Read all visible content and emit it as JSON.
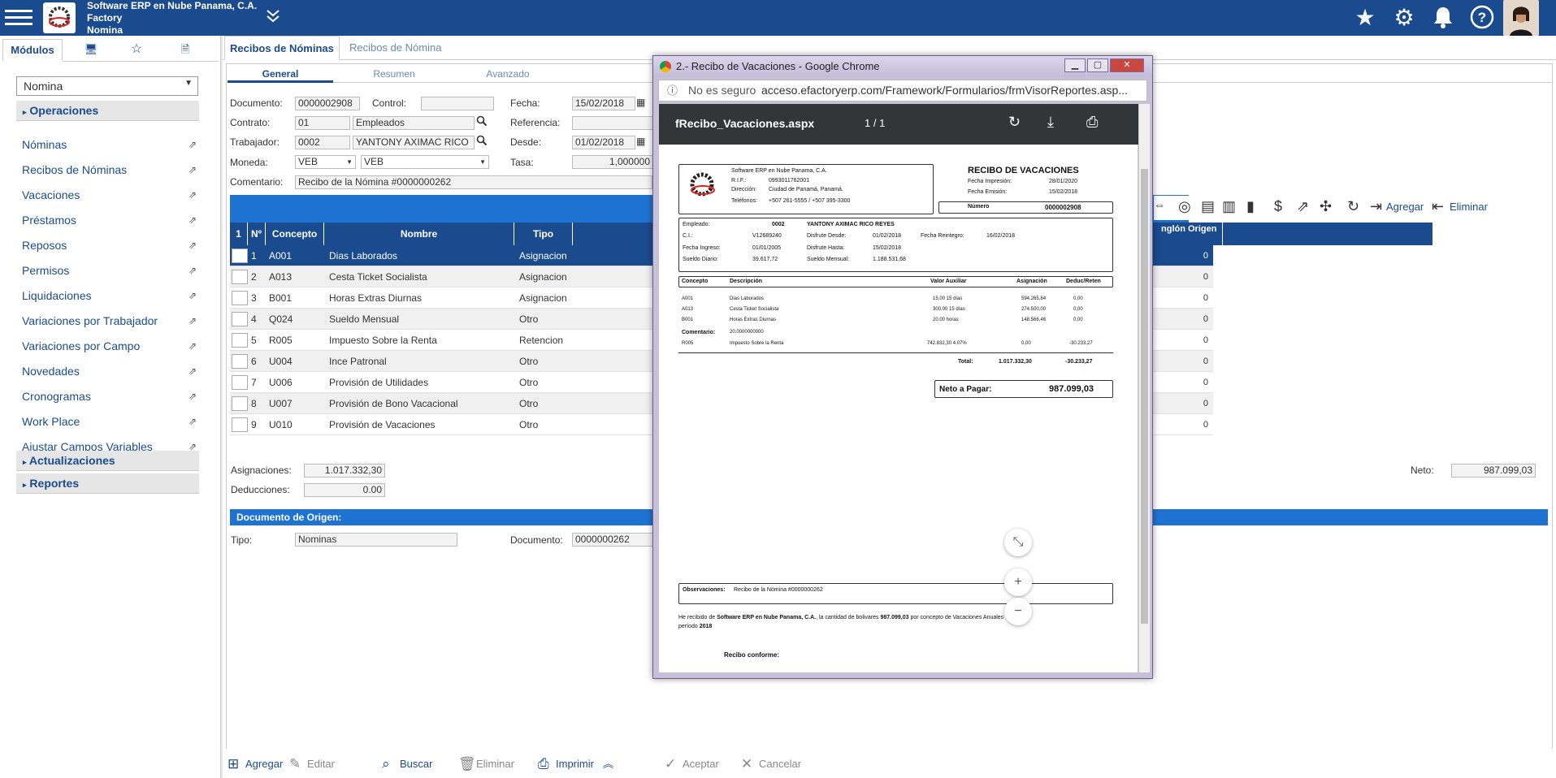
{
  "topbar": {
    "company": "Software ERP en Nube Panama, C.A.",
    "app": "Factory",
    "module": "Nomina",
    "icons": [
      "star-icon",
      "gear-icon",
      "bell-icon",
      "help-icon"
    ]
  },
  "sidebar": {
    "tab_modules": "Módulos",
    "selected_module": "Nomina",
    "groups": {
      "operaciones": "Operaciones",
      "actualizaciones": "Actualizaciones",
      "reportes": "Reportes"
    },
    "items": [
      "Nóminas",
      "Recibos de Nóminas",
      "Vacaciones",
      "Préstamos",
      "Reposos",
      "Permisos",
      "Liquidaciones",
      "Variaciones por Trabajador",
      "Variaciones por Campo",
      "Novedades",
      "Cronogramas",
      "Work Place",
      "Ajustar Campos Variables"
    ]
  },
  "main": {
    "tabs": [
      "Recibos de Nóminas",
      "Recibos de Nómina"
    ],
    "subtabs": [
      "General",
      "Resumen",
      "Avanzado"
    ],
    "form": {
      "documento_label": "Documento:",
      "documento": "0000002908",
      "control_label": "Control:",
      "control": "",
      "fecha_label": "Fecha:",
      "fecha": "15/02/2018",
      "contrato_label": "Contrato:",
      "contrato": "01",
      "contrato_desc": "Empleados",
      "referencia_label": "Referencia:",
      "trabajador_label": "Trabajador:",
      "trabajador": "0002",
      "trabajador_desc": "YANTONY AXIMAC RICO",
      "desde_label": "Desde:",
      "desde": "01/02/2018",
      "moneda_label": "Moneda:",
      "moneda": "VEB",
      "moneda_desc": "VEB",
      "tasa_label": "Tasa:",
      "tasa": "1,000000",
      "comentario_label": "Comentario:",
      "comentario": "Recibo de la Nómina #0000000262"
    },
    "grid": {
      "headers": [
        "1",
        "Nº",
        "Concepto",
        "Nombre",
        "Tipo"
      ],
      "right_header": "nglón Origen",
      "rows": [
        {
          "n": "1",
          "concepto": "A001",
          "nombre": "Dias Laborados",
          "tipo": "Asignacion",
          "origen": "0"
        },
        {
          "n": "2",
          "concepto": "A013",
          "nombre": "Cesta Ticket Socialista",
          "tipo": "Asignacion",
          "origen": "0"
        },
        {
          "n": "3",
          "concepto": "B001",
          "nombre": "Horas Extras Diurnas",
          "tipo": "Asignacion",
          "origen": "0"
        },
        {
          "n": "4",
          "concepto": "Q024",
          "nombre": "Sueldo Mensual",
          "tipo": "Otro",
          "origen": "0"
        },
        {
          "n": "5",
          "concepto": "R005",
          "nombre": "Impuesto Sobre la Renta",
          "tipo": "Retencion",
          "origen": "0"
        },
        {
          "n": "6",
          "concepto": "U004",
          "nombre": "Ince Patronal",
          "tipo": "Otro",
          "origen": "0"
        },
        {
          "n": "7",
          "concepto": "U006",
          "nombre": "Provisión de Utilidades",
          "tipo": "Otro",
          "origen": "0"
        },
        {
          "n": "8",
          "concepto": "U007",
          "nombre": "Provisión de Bono Vacacional",
          "tipo": "Otro",
          "origen": "0"
        },
        {
          "n": "9",
          "concepto": "U010",
          "nombre": "Provisión de Vacaciones",
          "tipo": "Otro",
          "origen": "0"
        }
      ]
    },
    "grid_toolbar": {
      "agregar": "Agregar",
      "eliminar": "Eliminar"
    },
    "totals": {
      "asignaciones_label": "Asignaciones:",
      "asignaciones": "1.017.332,30",
      "deducciones_label": "Deducciones:",
      "deducciones": "0.00",
      "neto_label": "Neto:",
      "neto": "987.099,03"
    },
    "origen": {
      "title": "Documento de Origen:",
      "tipo_label": "Tipo:",
      "tipo": "Nominas",
      "documento_label": "Documento:",
      "documento": "0000000262"
    },
    "bottombar": [
      "Agregar",
      "Editar",
      "Buscar",
      "Eliminar",
      "Imprimir",
      "Aceptar",
      "Cancelar"
    ]
  },
  "popup": {
    "title": "2.- Recibo de Vacaciones - Google Chrome",
    "not_secure": "No es seguro",
    "url": "acceso.efactoryerp.com/Framework/Formularios/frmVisorReportes.asp...",
    "pdf_name": "fRecibo_Vacaciones.aspx",
    "page": "1 / 1",
    "report": {
      "company": "Software ERP en Nube Panama, C.A.",
      "rif_label": "R.I.F.:",
      "rif": "0993011762001",
      "dir_label": "Dirección:",
      "dir": "Ciudad de Panamá, Panamá.",
      "tel_label": "Teléfonos:",
      "tel": "+507 261-5555 / +507 395-3300",
      "title": "RECIBO DE VACACIONES",
      "fecha_impresion_label": "Fecha Impresión:",
      "fecha_impresion": "28/01/2020",
      "fecha_emision_label": "Fecha Emisión:",
      "fecha_emision": "15/02/2018",
      "numero_label": "Número",
      "numero": "0000002908",
      "empleado_label": "Empleado:",
      "empleado_cod": "0002",
      "empleado_nombre": "YANTONY AXIMAC RICO REYES",
      "ci_label": "C.I.:",
      "ci": "V12689240",
      "disfrute_desde_label": "Disfrute Desde:",
      "disfrute_desde": "01/02/2018",
      "fecha_reintegro_label": "Fecha Reintegro:",
      "fecha_reintegro": "16/02/2018",
      "fecha_ingreso_label": "Fecha Ingreso:",
      "fecha_ingreso": "01/01/2005",
      "disfrute_hasta_label": "Disfrute Hasta:",
      "disfrute_hasta": "15/02/2018",
      "sueldo_diario_label": "Sueldo Diario:",
      "sueldo_diario": "39.617,72",
      "sueldo_mensual_label": "Sueldo Mensual:",
      "sueldo_mensual": "1.188.531,68",
      "cols": [
        "Concepto",
        "Descripción",
        "Valor Auxiliar",
        "Asignación",
        "Deduc/Reten"
      ],
      "lines": [
        {
          "c": "A001",
          "d": "Dias Laborados",
          "v": "15,00 15 días",
          "a": "594.265,84",
          "r": "0,00"
        },
        {
          "c": "A013",
          "d": "Cesta Ticket Socialista",
          "v": "300,00 15 días",
          "a": "274.500,00",
          "r": "0,00"
        },
        {
          "c": "B001",
          "d": "Horas Extras Diurnas",
          "v": "20.00 horas",
          "a": "148.566,46",
          "r": "0,00"
        }
      ],
      "comentario_label": "Comentario:",
      "comentario": "20.0000000000",
      "line_r005": {
        "c": "R005",
        "d": "Impuesto Sobre la Renta",
        "v": "742.832,30 4.07%",
        "a": "0,00",
        "r": "-30.233,27"
      },
      "total_label": "Total:",
      "total_a": "1.017.332,30",
      "total_r": "-30.233,27",
      "neto_label": "Neto a Pagar:",
      "neto": "987.099,03",
      "obs_label": "Observaciones:",
      "obs": "Recibo de la Nómina #0000000262",
      "recibido_1": "He recibido de",
      "recibido_company": "Software ERP en Nube Panama, C.A.",
      "recibido_2": ", la cantidad de bolivares",
      "recibido_monto": "987.099,03",
      "recibido_3": "por concepto de Vacaciones Anuales",
      "periodo_label": "período",
      "periodo": "2018",
      "conforme": "Recibo conforme:"
    }
  }
}
